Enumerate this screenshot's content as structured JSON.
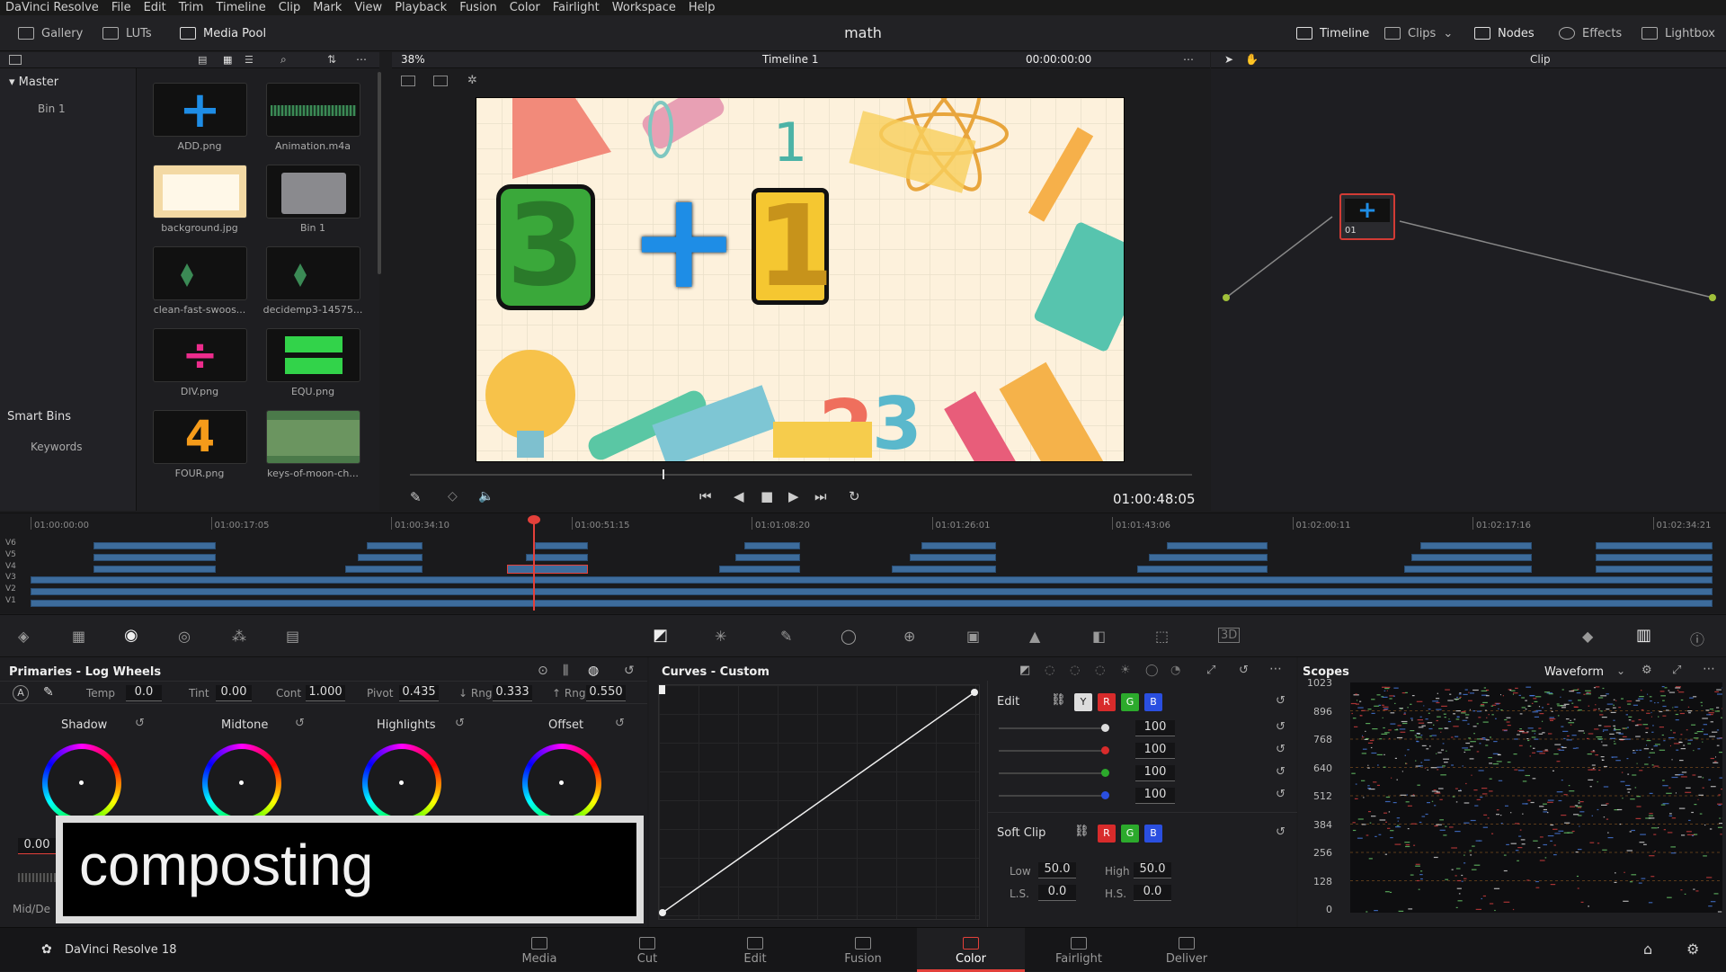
{
  "menu": [
    "DaVinci Resolve",
    "File",
    "Edit",
    "Trim",
    "Timeline",
    "Clip",
    "Mark",
    "View",
    "Playback",
    "Fusion",
    "Color",
    "Fairlight",
    "Workspace",
    "Help"
  ],
  "toolbar": {
    "gallery": "Gallery",
    "luts": "LUTs",
    "media_pool": "Media Pool",
    "project_title": "math",
    "timeline": "Timeline",
    "clips": "Clips",
    "nodes": "Nodes",
    "effects": "Effects",
    "lightbox": "Lightbox"
  },
  "left_panel": {
    "master": "Master",
    "bin": "Bin 1",
    "smart_bins": "Smart Bins",
    "keywords": "Keywords"
  },
  "media_pool": {
    "items": [
      {
        "name": "ADD.png",
        "kind": "plus"
      },
      {
        "name": "Animation.m4a",
        "kind": "audio"
      },
      {
        "name": "background.jpg",
        "kind": "background"
      },
      {
        "name": "Bin 1",
        "kind": "folder"
      },
      {
        "name": "clean-fast-swoos...",
        "kind": "audio-short"
      },
      {
        "name": "decidemp3-14575...",
        "kind": "audio-short"
      },
      {
        "name": "DIV.png",
        "kind": "div"
      },
      {
        "name": "EQU.png",
        "kind": "equ"
      },
      {
        "name": "FOUR.png",
        "kind": "four"
      },
      {
        "name": "keys-of-moon-ch...",
        "kind": "video"
      }
    ]
  },
  "viewer": {
    "zoom": "38%",
    "timeline_name": "Timeline 1",
    "timecode_top": "00:00:00:00",
    "timecode": "01:00:48:05",
    "equation": {
      "left": "3",
      "op": "+",
      "right": "1"
    },
    "clip_dropdown": "Clip"
  },
  "node": {
    "label": "01"
  },
  "timeline_ruler": [
    "01:00:00:00",
    "01:00:17:05",
    "01:00:34:10",
    "01:00:51:15",
    "01:01:08:20",
    "01:01:26:01",
    "01:01:43:06",
    "01:02:00:11",
    "01:02:17:16",
    "01:02:34:21"
  ],
  "tracks": [
    "V6",
    "V5",
    "V4",
    "V3",
    "V2",
    "V1"
  ],
  "primaries": {
    "title": "Primaries - Log Wheels",
    "temp_label": "Temp",
    "temp": "0.0",
    "tint_label": "Tint",
    "tint": "0.00",
    "cont_label": "Cont",
    "cont": "1.000",
    "pivot_label": "Pivot",
    "pivot": "0.435",
    "low_rng_label": "↓ Rng",
    "low_rng": "0.333",
    "high_rng_label": "↑ Rng",
    "high_rng": "0.550",
    "wheels": [
      "Shadow",
      "Midtone",
      "Highlights",
      "Offset"
    ],
    "side_value": "0.00",
    "mid_detail": "Mid/De"
  },
  "overlay_caption": "composting",
  "curves": {
    "title": "Curves - Custom",
    "edit_label": "Edit",
    "channels": [
      "Y",
      "R",
      "G",
      "B"
    ],
    "values": [
      "100",
      "100",
      "100",
      "100"
    ],
    "soft_clip": "Soft Clip",
    "low_label": "Low",
    "low": "50.0",
    "high_label": "High",
    "high": "50.0",
    "ls_label": "L.S.",
    "ls": "0.0",
    "hs_label": "H.S.",
    "hs": "0.0"
  },
  "scopes": {
    "title": "Scopes",
    "mode": "Waveform",
    "scale": [
      "1023",
      "896",
      "768",
      "640",
      "512",
      "384",
      "256",
      "128",
      "0"
    ]
  },
  "pages": [
    "Media",
    "Cut",
    "Edit",
    "Fusion",
    "Color",
    "Fairlight",
    "Deliver"
  ],
  "active_page": "Color",
  "app_name": "DaVinci Resolve 18",
  "colors": {
    "accent": "#e3403a",
    "clip": "#3d6c9c",
    "active_page": "#e3403a"
  }
}
